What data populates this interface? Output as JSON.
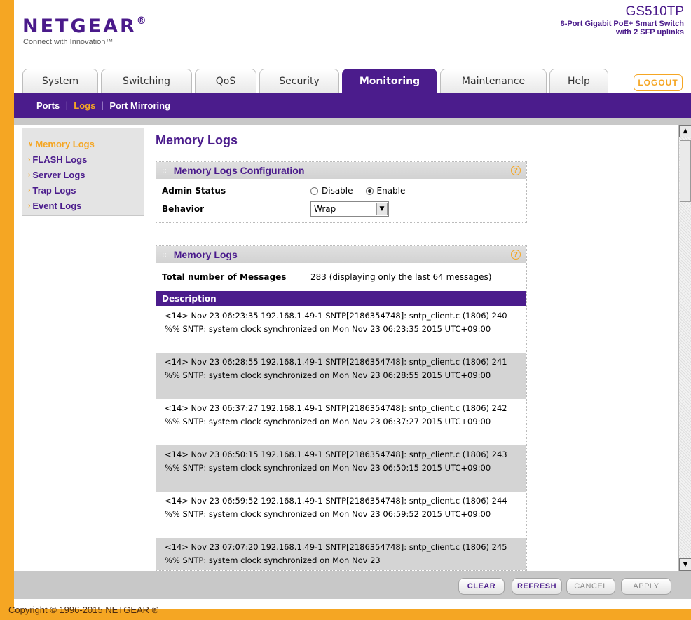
{
  "header": {
    "logo": "NETGEAR",
    "logo_mark": "®",
    "tagline": "Connect with Innovation™",
    "model": "GS510TP",
    "description_line1": "8-Port Gigabit PoE+ Smart Switch",
    "description_line2": "with 2 SFP uplinks"
  },
  "tabs": [
    {
      "label": "System"
    },
    {
      "label": "Switching"
    },
    {
      "label": "QoS"
    },
    {
      "label": "Security"
    },
    {
      "label": "Monitoring"
    },
    {
      "label": "Maintenance"
    },
    {
      "label": "Help"
    }
  ],
  "logout_label": "LOGOUT",
  "subnav": {
    "items": [
      {
        "label": "Ports"
      },
      {
        "label": "Logs"
      },
      {
        "label": "Port Mirroring"
      }
    ],
    "separator": "|"
  },
  "leftmenu": {
    "items": [
      {
        "label": "Memory Logs"
      },
      {
        "label": "FLASH Logs"
      },
      {
        "label": "Server Logs"
      },
      {
        "label": "Trap Logs"
      },
      {
        "label": "Event Logs"
      }
    ]
  },
  "main": {
    "title": "Memory Logs",
    "config": {
      "title": "Memory Logs Configuration",
      "admin_status_label": "Admin Status",
      "disable_label": "Disable",
      "enable_label": "Enable",
      "admin_status_value": "Enable",
      "behavior_label": "Behavior",
      "behavior_value": "Wrap"
    },
    "logs": {
      "title": "Memory Logs",
      "total_label": "Total number of Messages",
      "total_value": "283 (displaying only the last 64 messages)",
      "column_header": "Description",
      "rows": [
        "<14> Nov 23 06:23:35 192.168.1.49-1 SNTP[2186354748]: sntp_client.c (1806) 240 %% SNTP: system clock synchronized on Mon Nov 23 06:23:35 2015 UTC+09:00",
        "<14> Nov 23 06:28:55 192.168.1.49-1 SNTP[2186354748]: sntp_client.c (1806) 241 %% SNTP: system clock synchronized on Mon Nov 23 06:28:55 2015 UTC+09:00",
        "<14> Nov 23 06:37:27 192.168.1.49-1 SNTP[2186354748]: sntp_client.c (1806) 242 %% SNTP: system clock synchronized on Mon Nov 23 06:37:27 2015 UTC+09:00",
        "<14> Nov 23 06:50:15 192.168.1.49-1 SNTP[2186354748]: sntp_client.c (1806) 243 %% SNTP: system clock synchronized on Mon Nov 23 06:50:15 2015 UTC+09:00",
        "<14> Nov 23 06:59:52 192.168.1.49-1 SNTP[2186354748]: sntp_client.c (1806) 244 %% SNTP: system clock synchronized on Mon Nov 23 06:59:52 2015 UTC+09:00",
        "<14> Nov 23 07:07:20 192.168.1.49-1 SNTP[2186354748]: sntp_client.c (1806) 245 %% SNTP: system clock synchronized on Mon Nov 23"
      ]
    }
  },
  "buttons": {
    "clear": "CLEAR",
    "refresh": "REFRESH",
    "cancel": "CANCEL",
    "apply": "APPLY"
  },
  "footer": "Copyright © 1996-2015 NETGEAR ®",
  "colors": {
    "brand_purple": "#4b1c8c",
    "accent_orange": "#f5a623"
  },
  "icons": {
    "help": "help-icon",
    "grip": "grip-icon",
    "arrow": "arrow-icon",
    "dropdown": "chevron-down-icon"
  }
}
